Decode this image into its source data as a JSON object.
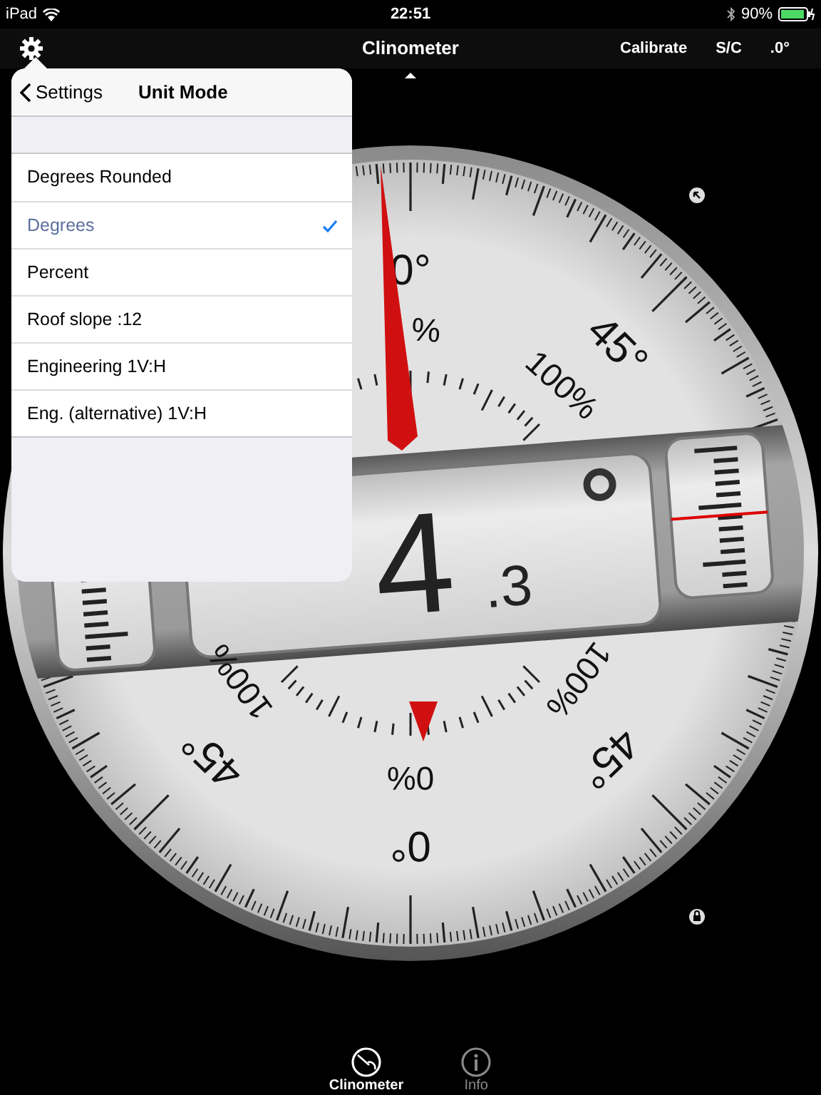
{
  "status_bar": {
    "device": "iPad",
    "time": "22:51",
    "battery": "90%"
  },
  "nav_bar": {
    "title": "Clinometer",
    "actions": [
      "Calibrate",
      "S/C",
      ".0°"
    ]
  },
  "popover": {
    "back": "Settings",
    "title": "Unit Mode",
    "items": [
      {
        "label": "Degrees Rounded",
        "selected": false
      },
      {
        "label": "Degrees",
        "selected": true
      },
      {
        "label": "Percent",
        "selected": false
      },
      {
        "label": "Roof slope :12",
        "selected": false
      },
      {
        "label": "Engineering 1V:H",
        "selected": false
      },
      {
        "label": "Eng. (alternative) 1V:H",
        "selected": false
      }
    ]
  },
  "dial": {
    "degree_labels": [
      "0°",
      "45°",
      "45°",
      "45°",
      "0°"
    ],
    "percent_labels": [
      "%",
      "100%",
      "100%",
      "100%",
      "0%"
    ],
    "reading": {
      "whole": "4",
      "fraction": ".3"
    }
  },
  "tab_bar": [
    {
      "label": "Clinometer",
      "selected": true
    },
    {
      "label": "Info",
      "selected": false
    }
  ]
}
